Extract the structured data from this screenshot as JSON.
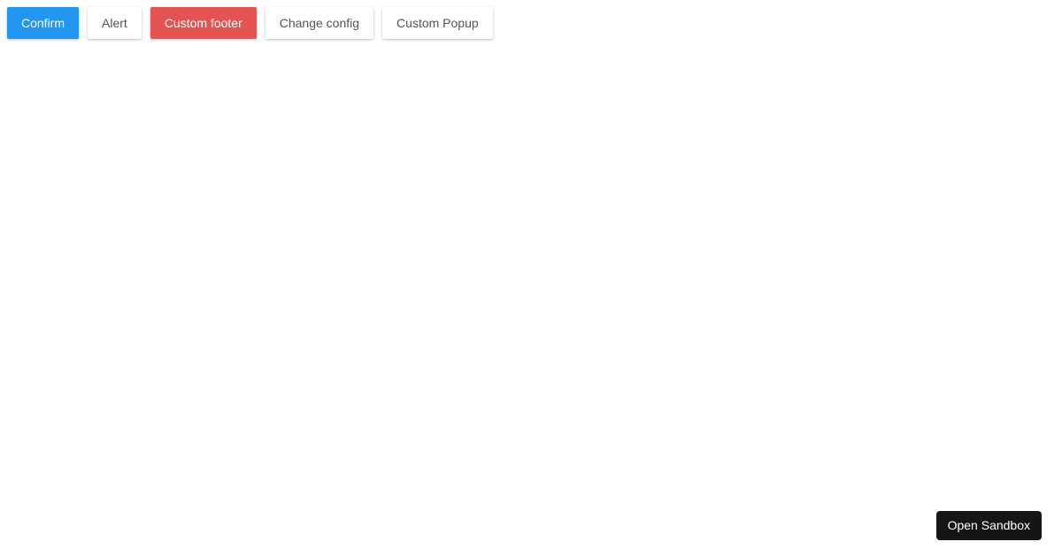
{
  "toolbar": {
    "buttons": [
      {
        "label": "Confirm"
      },
      {
        "label": "Alert"
      },
      {
        "label": "Custom footer"
      },
      {
        "label": "Change config"
      },
      {
        "label": "Custom Popup"
      }
    ]
  },
  "sandbox": {
    "label": "Open Sandbox"
  },
  "colors": {
    "primary": "#2196f3",
    "danger": "#e55353",
    "sandbox_bg": "#151515",
    "default_text": "#555555"
  }
}
